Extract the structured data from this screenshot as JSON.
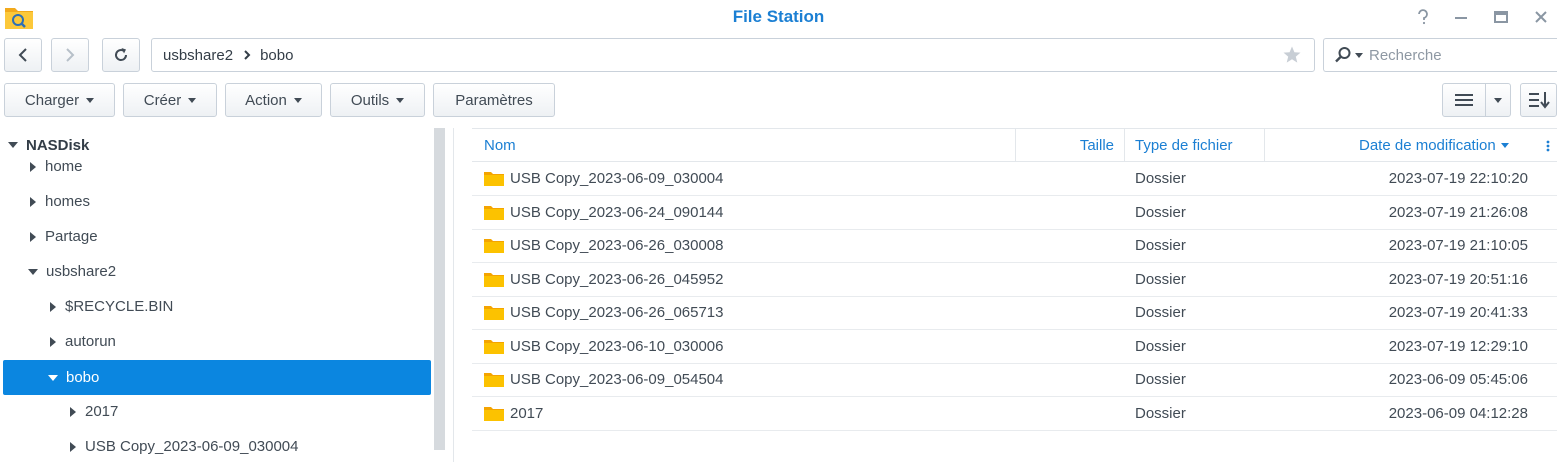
{
  "window": {
    "title": "File Station",
    "app_icon": "file-station-icon",
    "controls": [
      "help-icon",
      "minimize-icon",
      "maximize-icon",
      "close-icon"
    ]
  },
  "navigation": {
    "path": [
      "usbshare2",
      "bobo"
    ],
    "search_placeholder": "Recherche"
  },
  "toolbar": {
    "upload_label": "Charger",
    "create_label": "Créer",
    "action_label": "Action",
    "tools_label": "Outils",
    "settings_label": "Paramètres"
  },
  "tree": {
    "root": "NASDisk",
    "items": [
      {
        "label": "home",
        "level": 1,
        "state": "collapsed"
      },
      {
        "label": "homes",
        "level": 1,
        "state": "collapsed"
      },
      {
        "label": "Partage",
        "level": 1,
        "state": "collapsed"
      },
      {
        "label": "usbshare2",
        "level": 1,
        "state": "expanded"
      },
      {
        "label": "$RECYCLE.BIN",
        "level": 2,
        "state": "collapsed"
      },
      {
        "label": "autorun",
        "level": 2,
        "state": "collapsed"
      },
      {
        "label": "bobo",
        "level": 2,
        "state": "expanded",
        "selected": true
      },
      {
        "label": "2017",
        "level": 3,
        "state": "collapsed"
      },
      {
        "label": "USB Copy_2023-06-09_030004",
        "level": 3,
        "state": "collapsed"
      }
    ]
  },
  "table": {
    "columns": {
      "name": "Nom",
      "size": "Taille",
      "type": "Type de fichier",
      "modified": "Date de modification"
    },
    "rows": [
      {
        "name": "USB Copy_2023-06-09_030004",
        "size": "",
        "type": "Dossier",
        "modified": "2023-07-19 22:10:20"
      },
      {
        "name": "USB Copy_2023-06-24_090144",
        "size": "",
        "type": "Dossier",
        "modified": "2023-07-19 21:26:08"
      },
      {
        "name": "USB Copy_2023-06-26_030008",
        "size": "",
        "type": "Dossier",
        "modified": "2023-07-19 21:10:05"
      },
      {
        "name": "USB Copy_2023-06-26_045952",
        "size": "",
        "type": "Dossier",
        "modified": "2023-07-19 20:51:16"
      },
      {
        "name": "USB Copy_2023-06-26_065713",
        "size": "",
        "type": "Dossier",
        "modified": "2023-07-19 20:41:33"
      },
      {
        "name": "USB Copy_2023-06-10_030006",
        "size": "",
        "type": "Dossier",
        "modified": "2023-07-19 12:29:10"
      },
      {
        "name": "USB Copy_2023-06-09_054504",
        "size": "",
        "type": "Dossier",
        "modified": "2023-06-09 05:45:06"
      },
      {
        "name": "2017",
        "size": "",
        "type": "Dossier",
        "modified": "2023-06-09 04:12:28"
      }
    ]
  },
  "colors": {
    "accent": "#1b7fd3",
    "selection": "#0b86e0",
    "folder": "#f7b500"
  }
}
